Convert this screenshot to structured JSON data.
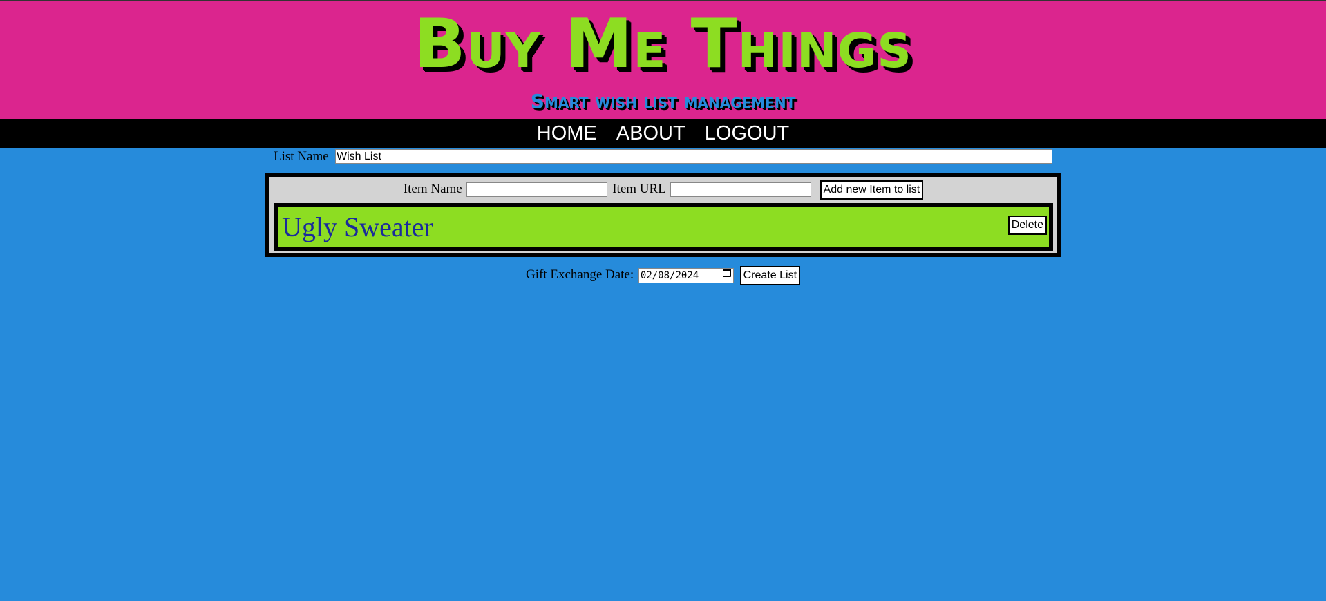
{
  "header": {
    "title": "Buy Me Things",
    "subtitle": "Smart wish list management"
  },
  "nav": {
    "items": [
      {
        "label": "HOME"
      },
      {
        "label": "ABOUT"
      },
      {
        "label": "LOGOUT"
      }
    ]
  },
  "list": {
    "name_label": "List Name",
    "name_value": "Wish List"
  },
  "add_item": {
    "name_label": "Item Name",
    "url_label": "Item URL",
    "button_label": "Add new Item to list",
    "name_value": "",
    "url_value": ""
  },
  "items": [
    {
      "name": "Ugly Sweater",
      "delete_label": "Delete"
    }
  ],
  "exchange": {
    "date_label": "Gift Exchange Date:",
    "date_value": "02/08/2024",
    "create_label": "Create List"
  },
  "colors": {
    "header_bg": "#db258e",
    "page_bg": "#268bdb",
    "accent_green": "#8ddd22",
    "nav_bg": "#000000",
    "panel_bg": "#d3d3d3",
    "item_text": "#1a2a9c"
  },
  "icons": {
    "date_picker": "calendar-icon"
  }
}
